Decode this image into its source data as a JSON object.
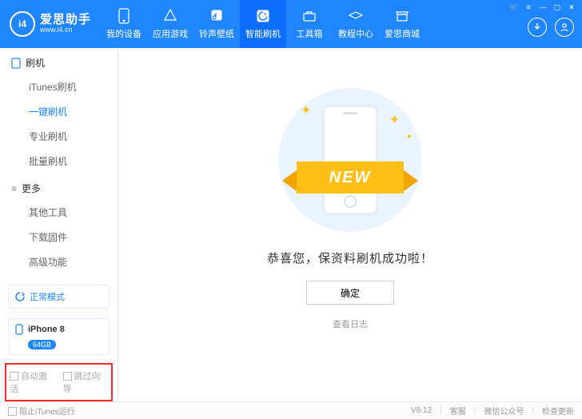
{
  "brand": {
    "cn": "爱思助手",
    "en": "www.i4.cn",
    "logo_text": "i4"
  },
  "nav": [
    {
      "name": "device",
      "label": "我的设备"
    },
    {
      "name": "apps",
      "label": "应用游戏"
    },
    {
      "name": "ringtone",
      "label": "铃声壁纸"
    },
    {
      "name": "flash",
      "label": "智能刷机",
      "active": true
    },
    {
      "name": "toolbox",
      "label": "工具箱"
    },
    {
      "name": "tutorial",
      "label": "教程中心"
    },
    {
      "name": "mall",
      "label": "爱思商城"
    }
  ],
  "sidebar": {
    "group_flash": "刷机",
    "flash_items": [
      {
        "label": "iTunes刷机"
      },
      {
        "label": "一键刷机",
        "active": true
      },
      {
        "label": "专业刷机"
      },
      {
        "label": "批量刷机"
      }
    ],
    "group_more": "更多",
    "more_items": [
      {
        "label": "其他工具"
      },
      {
        "label": "下载固件"
      },
      {
        "label": "高级功能"
      }
    ],
    "mode": {
      "label": "正常模式"
    },
    "device": {
      "name": "iPhone 8",
      "capacity": "64GB"
    },
    "auto_activate": "自动激活",
    "skip_wizard": "跳过向导"
  },
  "main": {
    "ribbon_text": "NEW",
    "message": "恭喜您，保资料刷机成功啦！",
    "confirm": "确定",
    "view_log": "查看日志"
  },
  "footer": {
    "block_itunes": "阻止iTunes运行",
    "version": "V8.12",
    "support": "客服",
    "wechat": "微信公众号",
    "update": "检查更新"
  }
}
